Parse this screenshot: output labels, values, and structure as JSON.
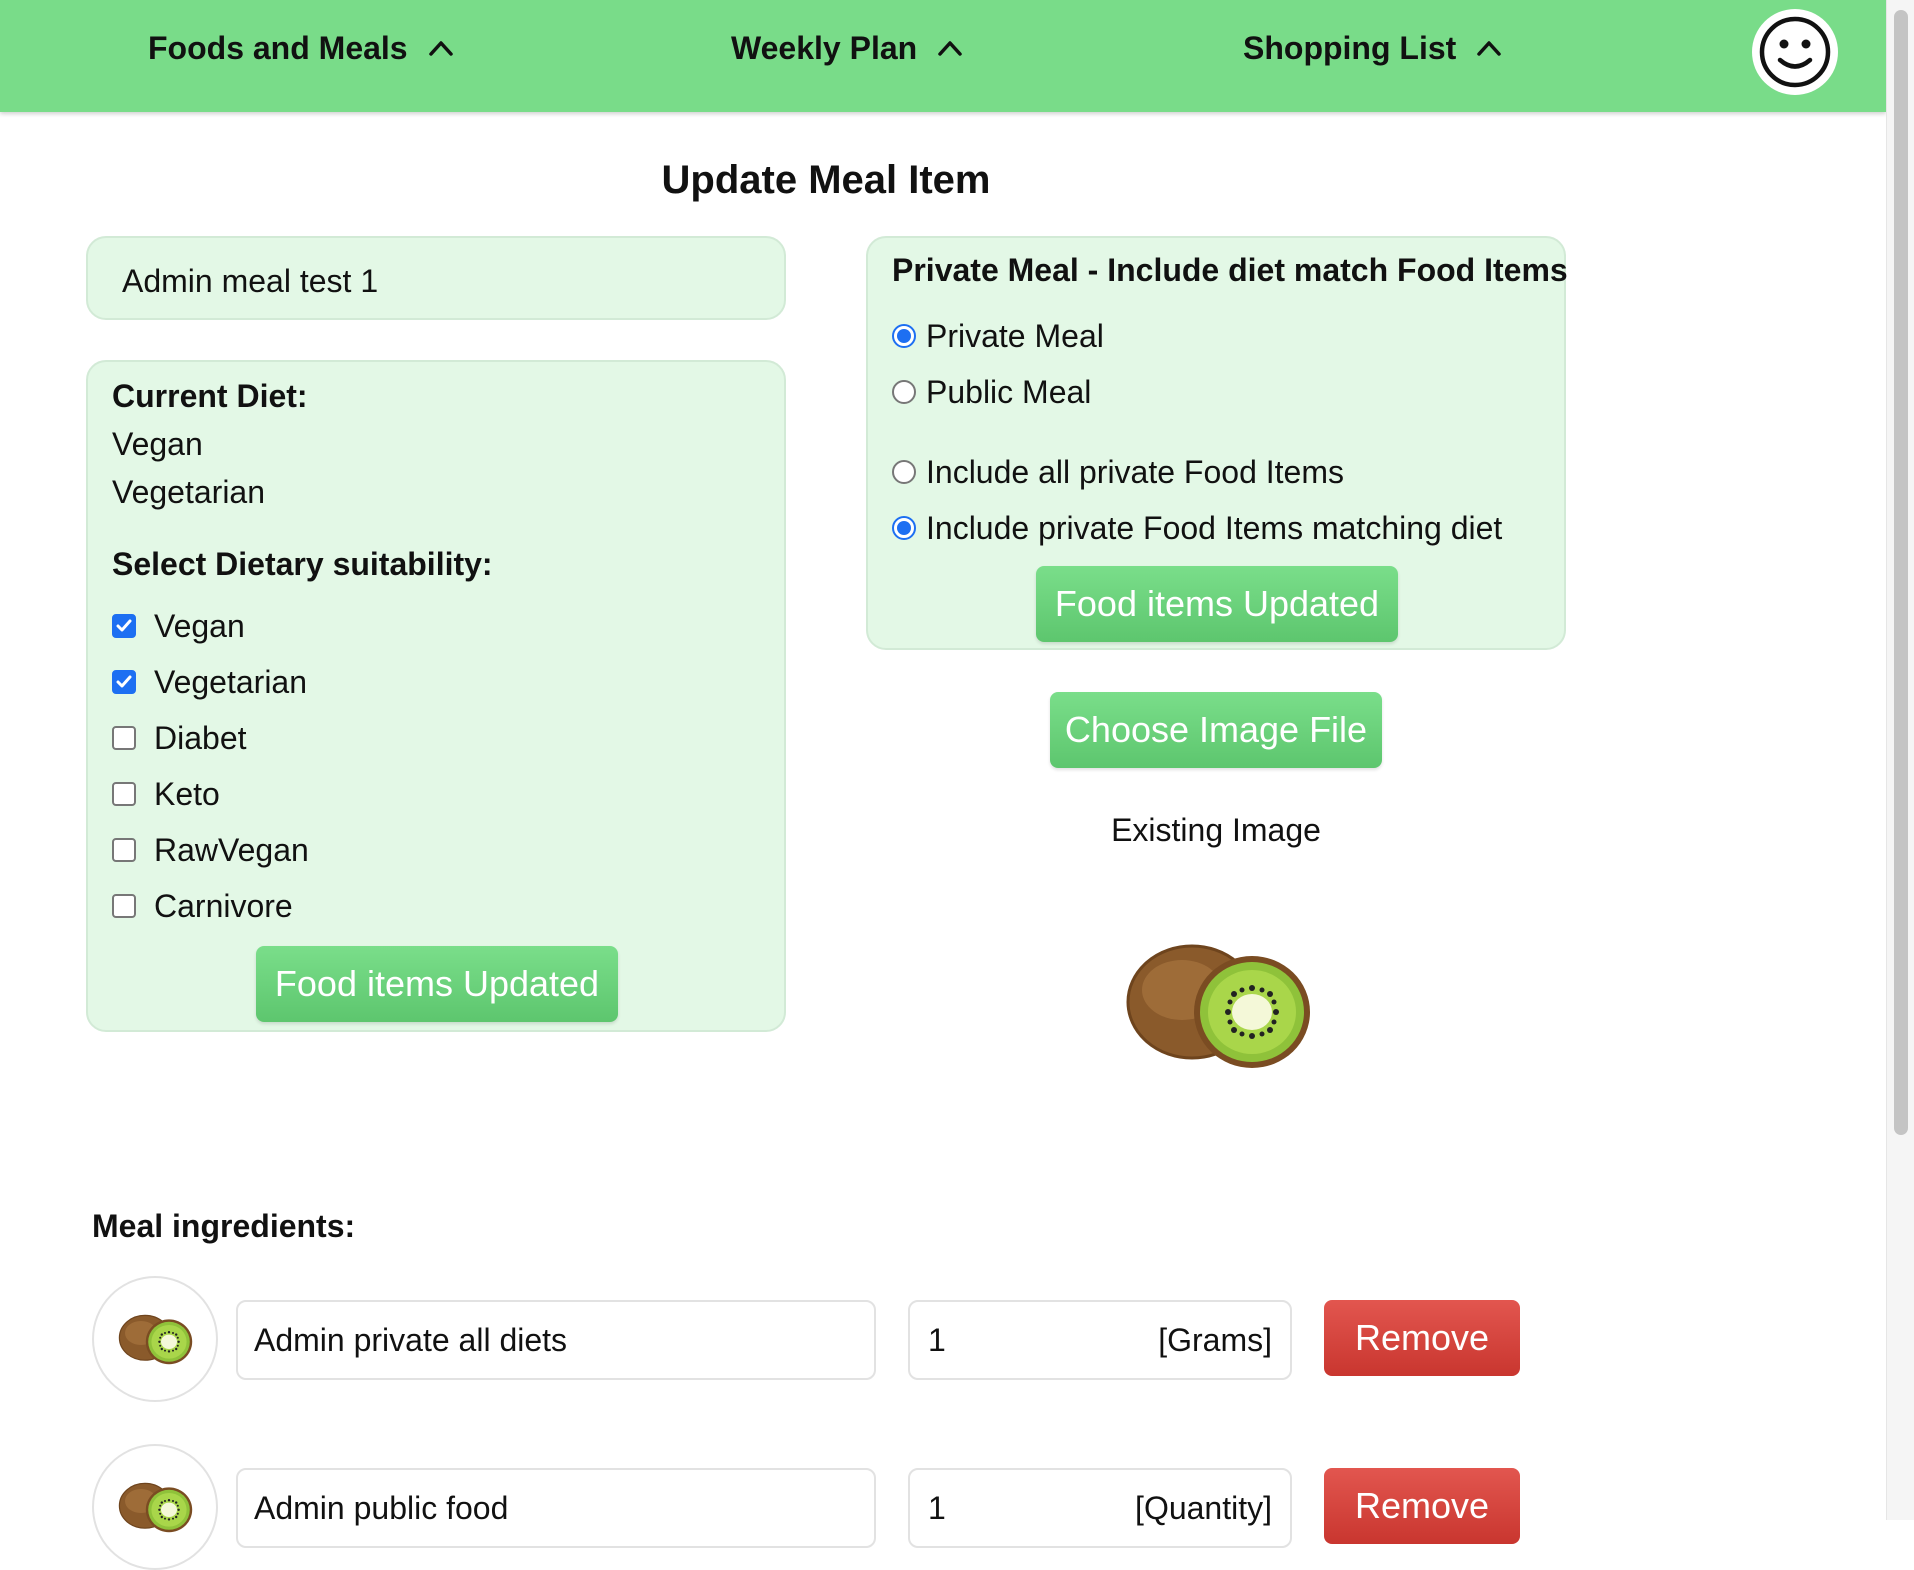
{
  "nav": {
    "foods": "Foods and Meals",
    "weekly": "Weekly Plan",
    "shopping": "Shopping List"
  },
  "page_title": "Update Meal Item",
  "meal_name": "Admin meal test 1",
  "diet": {
    "current_label": "Current Diet:",
    "current": [
      "Vegan",
      "Vegetarian"
    ],
    "select_label": "Select Dietary suitability:",
    "options": [
      {
        "label": "Vegan",
        "checked": true
      },
      {
        "label": "Vegetarian",
        "checked": true
      },
      {
        "label": "Diabet",
        "checked": false
      },
      {
        "label": "Keto",
        "checked": false
      },
      {
        "label": "RawVegan",
        "checked": false
      },
      {
        "label": "Carnivore",
        "checked": false
      }
    ],
    "button": "Food items Updated"
  },
  "privacy": {
    "title": "Private Meal - Include diet match Food Items",
    "visibility": [
      {
        "label": "Private Meal",
        "selected": true
      },
      {
        "label": "Public Meal",
        "selected": false
      }
    ],
    "include": [
      {
        "label": "Include all private Food Items",
        "selected": false
      },
      {
        "label": "Include private Food Items matching diet",
        "selected": true
      }
    ],
    "button": "Food items Updated"
  },
  "image": {
    "choose_button": "Choose Image File",
    "existing_label": "Existing Image"
  },
  "ingredients": {
    "title": "Meal ingredients:",
    "items": [
      {
        "name": "Admin private all diets",
        "qty": "1",
        "unit": "[Grams]",
        "remove": "Remove"
      },
      {
        "name": "Admin public food",
        "qty": "1",
        "unit": "[Quantity]",
        "remove": "Remove"
      }
    ]
  },
  "colors": {
    "nav_bg": "#79dc89",
    "panel_bg": "#e3f8e6",
    "accent_green": "#66cf77",
    "remove_red": "#d6433c",
    "check_blue": "#1d6ff2"
  },
  "icons": {
    "nav_chevron": "chevron-up-icon",
    "avatar": "smiley-face-icon",
    "meal_image": "kiwi-image"
  }
}
